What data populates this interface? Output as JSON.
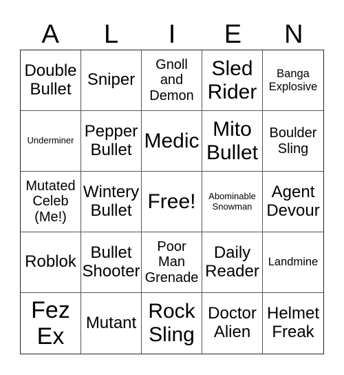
{
  "card": {
    "header_letters": [
      "A",
      "L",
      "I",
      "E",
      "N"
    ],
    "rows": [
      [
        {
          "text": "Double Bullet",
          "size": "xl"
        },
        {
          "text": "Sniper",
          "size": "xl"
        },
        {
          "text": "Gnoll and Demon",
          "size": "lg"
        },
        {
          "text": "Sled Rider",
          "size": "xxl"
        },
        {
          "text": "Banga Explosive",
          "size": "md"
        }
      ],
      [
        {
          "text": "Underminer",
          "size": "sm"
        },
        {
          "text": "Pepper Bullet",
          "size": "xl"
        },
        {
          "text": "Medic",
          "size": "xxl"
        },
        {
          "text": "Mito Bullet",
          "size": "xxl"
        },
        {
          "text": "Boulder Sling",
          "size": "lg"
        }
      ],
      [
        {
          "text": "Mutated Celeb (Me!)",
          "size": "lg"
        },
        {
          "text": "Wintery Bullet",
          "size": "xl"
        },
        {
          "text": "Free!",
          "size": "xxl"
        },
        {
          "text": "Abominable Snowman",
          "size": "sm"
        },
        {
          "text": "Agent Devour",
          "size": "xl"
        }
      ],
      [
        {
          "text": "Roblok",
          "size": "xl"
        },
        {
          "text": "Bullet Shooter",
          "size": "xl"
        },
        {
          "text": "Poor Man Grenade",
          "size": "lg"
        },
        {
          "text": "Daily Reader",
          "size": "xl"
        },
        {
          "text": "Landmine",
          "size": "md"
        }
      ],
      [
        {
          "text": "Fez Ex",
          "size": "xxxl"
        },
        {
          "text": "Mutant",
          "size": "xl"
        },
        {
          "text": "Rock Sling",
          "size": "xxl"
        },
        {
          "text": "Doctor Alien",
          "size": "xl"
        },
        {
          "text": "Helmet Freak",
          "size": "xl"
        }
      ]
    ]
  }
}
